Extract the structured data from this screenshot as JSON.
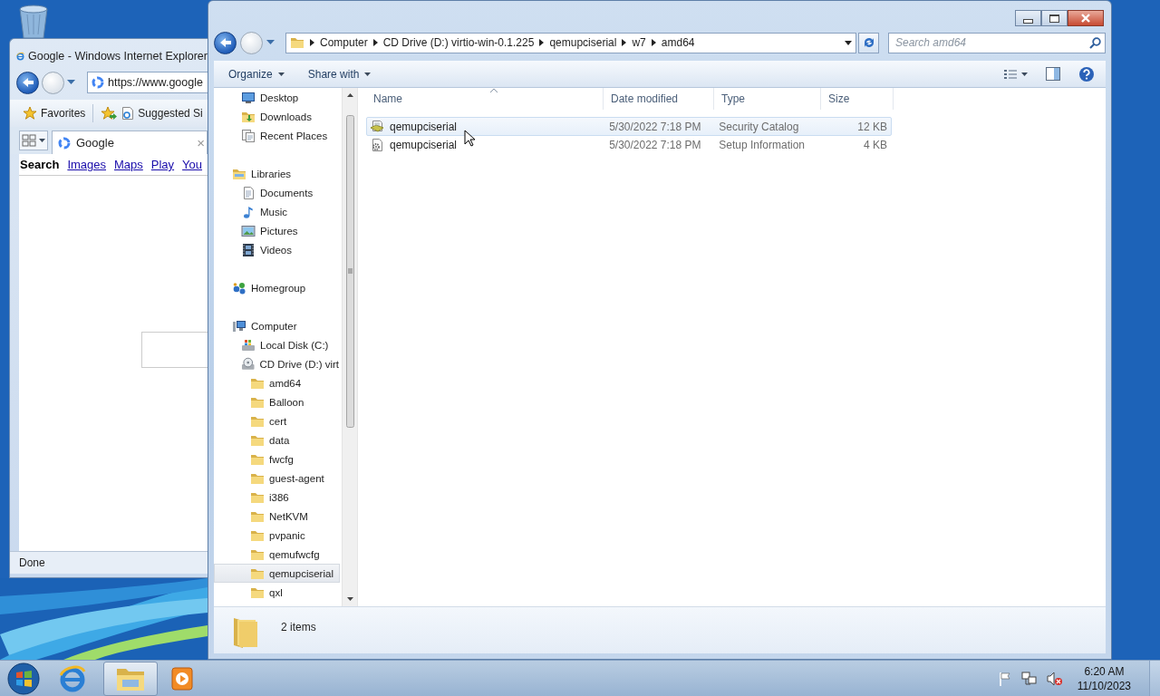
{
  "browser_window": {
    "title": "Google - Windows Internet Explorer",
    "address": "https://www.google",
    "favorites_label": "Favorites",
    "suggested_label": "Suggested Si",
    "tab": {
      "title": "Google",
      "close": "×"
    },
    "links": [
      {
        "label": "Search",
        "selected": true
      },
      {
        "label": "Images",
        "selected": false
      },
      {
        "label": "Maps",
        "selected": false
      },
      {
        "label": "Play",
        "selected": false
      },
      {
        "label": "You",
        "selected": false
      }
    ],
    "status": "Done"
  },
  "explorer": {
    "breadcrumb": [
      "Computer",
      "CD Drive (D:) virtio-win-0.1.225",
      "qemupciserial",
      "w7",
      "amd64"
    ],
    "search": {
      "placeholder": "Search amd64"
    },
    "toolbar": [
      "Organize",
      "Share with"
    ],
    "nav_pane": {
      "groups": [
        {
          "children": [
            {
              "label": "Desktop",
              "kind": "desktop",
              "selected": false
            },
            {
              "label": "Downloads",
              "kind": "downloads",
              "selected": false
            },
            {
              "label": "Recent Places",
              "kind": "recent",
              "selected": false
            }
          ]
        },
        {
          "label": "Libraries",
          "kind": "library",
          "selected": false,
          "children": [
            {
              "label": "Documents",
              "kind": "documents",
              "selected": false
            },
            {
              "label": "Music",
              "kind": "music",
              "selected": false
            },
            {
              "label": "Pictures",
              "kind": "pictures",
              "selected": false
            },
            {
              "label": "Videos",
              "kind": "videos",
              "selected": false
            }
          ]
        },
        {
          "label": "Homegroup",
          "kind": "homegroup",
          "selected": false
        },
        {
          "label": "Computer",
          "kind": "computer",
          "selected": false,
          "children": [
            {
              "label": "Local Disk (C:)",
              "kind": "disk",
              "selected": false
            },
            {
              "label": "CD Drive (D:) virt",
              "kind": "cd",
              "selected": false,
              "children": [
                {
                  "label": "amd64",
                  "kind": "folder",
                  "selected": false
                },
                {
                  "label": "Balloon",
                  "kind": "folder",
                  "selected": false
                },
                {
                  "label": "cert",
                  "kind": "folder",
                  "selected": false
                },
                {
                  "label": "data",
                  "kind": "folder",
                  "selected": false
                },
                {
                  "label": "fwcfg",
                  "kind": "folder",
                  "selected": false
                },
                {
                  "label": "guest-agent",
                  "kind": "folder",
                  "selected": false
                },
                {
                  "label": "i386",
                  "kind": "folder",
                  "selected": false
                },
                {
                  "label": "NetKVM",
                  "kind": "folder",
                  "selected": false
                },
                {
                  "label": "pvpanic",
                  "kind": "folder",
                  "selected": false
                },
                {
                  "label": "qemufwcfg",
                  "kind": "folder",
                  "selected": false
                },
                {
                  "label": "qemupciserial",
                  "kind": "folder",
                  "selected": true
                },
                {
                  "label": "qxl",
                  "kind": "folder",
                  "selected": false
                }
              ]
            }
          ]
        }
      ]
    },
    "columns": [
      "Name",
      "Date modified",
      "Type",
      "Size"
    ],
    "rows": [
      {
        "name": "qemupciserial",
        "date_modified": "5/30/2022 7:18 PM",
        "type": "Security Catalog",
        "size": "12 KB",
        "kind": "catalog",
        "selected": true
      },
      {
        "name": "qemupciserial",
        "date_modified": "5/30/2022 7:18 PM",
        "type": "Setup Information",
        "size": "4 KB",
        "kind": "setup",
        "selected": false
      }
    ],
    "status": "2 items"
  },
  "taskbar": {
    "apps": [
      {
        "kind": "ie",
        "selected": false
      },
      {
        "kind": "explorer",
        "selected": true
      },
      {
        "kind": "media",
        "selected": false
      }
    ],
    "time": "6:20 AM",
    "date": "11/10/2023"
  }
}
